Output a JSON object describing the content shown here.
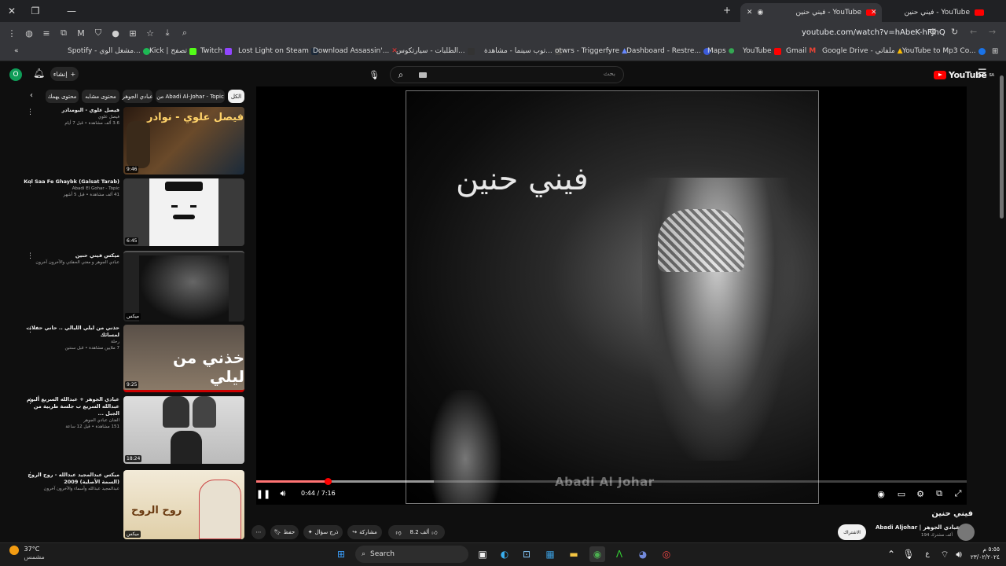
{
  "browser": {
    "tabs": [
      {
        "title": "فيني حنين - YouTube",
        "active": true
      },
      {
        "title": "فيني حنين - YouTube",
        "active": false
      }
    ],
    "new_tab": "+",
    "url": "youtube.com/watch?v=hAbeK-hFJhQ",
    "bookmarks": [
      "Spotify - مشغل الوي...",
      "Kick | تصفح",
      "Twitch",
      "Lost Light on Steam",
      "Download Assassin'...",
      "الطلبات - سيارتكوس...",
      "توب سينما - مشاهدة...",
      "otwrs - Triggerfyre",
      "Dashboard - Restre...",
      "Maps",
      "YouTube",
      "Gmail",
      "Google Drive - ملفاتي",
      "YouTube to Mp3 Co..."
    ]
  },
  "youtube": {
    "logo": "YouTube",
    "logo_sup": "SA",
    "search_placeholder": "بحث",
    "create_label": "إنشاء",
    "avatar_letter": "O",
    "chips": [
      "الكل",
      "من Abadi Al-Johar - Topic",
      "عبادي الجوهر",
      "محتوى مشابه",
      "محتوى يهمك"
    ]
  },
  "recommendations": [
    {
      "title": "فيصل علوي - البومنادر",
      "channel": "فيصل علوي",
      "meta": "3.6 ألف مشاهدة • قبل 7 أيام",
      "duration": "9:46",
      "thumb_text": "فيصل علوي - نوادر"
    },
    {
      "title": "Kol Saa Fe Ghaybk (Galsat Tarab)",
      "channel": "Abadi El Gohar - Topic",
      "meta": "41 ألف مشاهدة • قبل 5 أشهر",
      "duration": "6:45",
      "thumb_text": ""
    },
    {
      "title": "ميكس فيني حنين",
      "channel": "عبادي الجوهر و مغني الحفلتي والآخرون آخرون",
      "meta": "",
      "duration": "ميكس",
      "thumb_text": ""
    },
    {
      "title": "حذني من ليلي الليالي .. حاني حفلات لمسائك",
      "channel": "رحلة",
      "meta": "7 ملايين مشاهدة • قبل سنتين",
      "duration": "9:25",
      "thumb_text": "خذني من ليلي"
    },
    {
      "title": "عبادي الجوهر + عبدالله السريع ألبوم عبدالله السريع ب جلسة طربية من الجبل ...",
      "channel": "الفنان عبادي الجوهر",
      "meta": "151 مشاهدة • قبل 12 ساعة",
      "duration": "18:24",
      "thumb_text": ""
    },
    {
      "title": "ميكس عبدالمجيد عبدالله - روح الروح (السمة الأصلية) 2009",
      "channel": "عبدالمجيد عبدالله وأسماء والآخرون آخرون",
      "meta": "",
      "duration": "ميكس",
      "thumb_text": "روح الروح"
    }
  ],
  "player": {
    "calligraphy": "فيني حنين",
    "watermark": "Abadi Al Johar",
    "time_current": "0:44",
    "time_total": "7:16",
    "progress_fraction": 0.101,
    "buffered_fraction": 0.25
  },
  "video": {
    "title": "فيني حنين",
    "channel": "عبادي الجوهر | Abadi Aljohar",
    "subscribers": "194 ألف مشترك",
    "subscribe_label": "الاشتراك",
    "likes": "8.2 ألف",
    "share_label": "مشاركة",
    "remix_label": "ذرج سؤال",
    "save_label": "حفظ"
  },
  "taskbar": {
    "weather_temp": "37°C",
    "weather_desc": "مشمس",
    "search_label": "Search",
    "time": "٥:٥٥ م",
    "date": "٢٣/٠٢/٢٠٢٤",
    "lang": "ع"
  }
}
